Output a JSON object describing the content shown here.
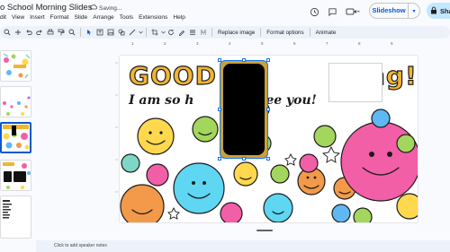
{
  "title_bar": {
    "doc_title": "o School Morning Slides",
    "saving": "Saving...",
    "menu": [
      "dit",
      "View",
      "Insert",
      "Format",
      "Slide",
      "Arrange",
      "Tools",
      "Extensions",
      "Help"
    ],
    "slideshow_label": "Slideshow",
    "share_label": "Sha"
  },
  "toolbar": {
    "replace_image": "Replace image",
    "format_options": "Format options",
    "animate": "Animate"
  },
  "ruler": {
    "marks": [
      "1",
      "2",
      "3",
      "4",
      "5",
      "6",
      "7",
      "8",
      "9"
    ]
  },
  "slide": {
    "headline": "GOOD M",
    "headline_end": "ning!",
    "subline": "I am so h",
    "subline_end": "see you!"
  },
  "filmstrip": {
    "thumbs": [
      "thumb-1",
      "thumb-2",
      "thumb-3",
      "thumb-4",
      "thumb-5"
    ],
    "selected_index": 2
  },
  "notes": {
    "placeholder": "Click to add speaker notes"
  },
  "colors": {
    "accent": "#0b57d0",
    "toolbar_bg": "#edf2fa",
    "share_bg": "#c2e7ff",
    "headline": "#f2b431"
  }
}
